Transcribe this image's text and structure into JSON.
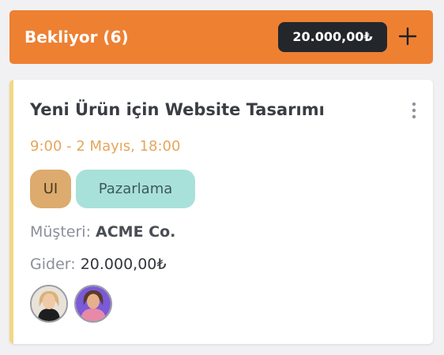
{
  "column": {
    "title": "Bekliyor (6)",
    "total": "20.000,00₺",
    "add_icon": "plus-icon",
    "header_color": "#ee8032"
  },
  "card": {
    "title": "Yeni Ürün için Website Tasarımı",
    "menu_icon": "more-vertical-icon",
    "date_range": "9:00 - 2 Mayıs, 18:00",
    "accent_color": "#f2d784",
    "tags": [
      {
        "label": "UI",
        "color": "#dcab6d"
      },
      {
        "label": "Pazarlama",
        "color": "#a8e1da"
      }
    ],
    "customer_label": "Müşteri:",
    "customer_value": "ACME Co.",
    "expense_label": "Gider:",
    "expense_value": "20.000,00₺",
    "assignees": [
      {
        "avatar": "user-avatar-1"
      },
      {
        "avatar": "user-avatar-2"
      }
    ]
  }
}
